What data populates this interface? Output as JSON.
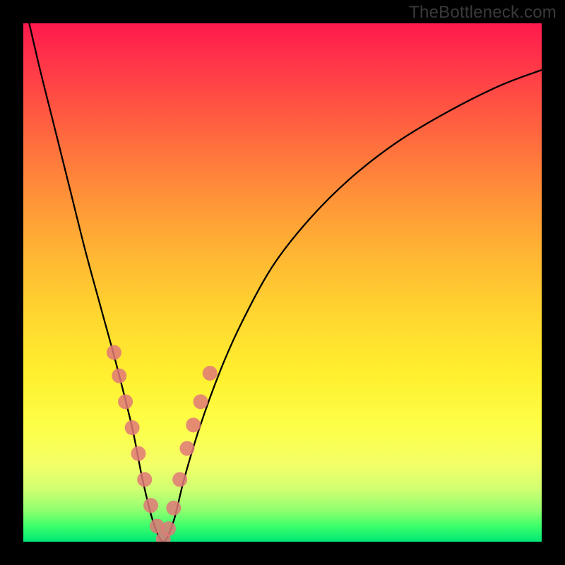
{
  "watermark": "TheBottleneck.com",
  "chart_data": {
    "type": "line",
    "title": "",
    "xlabel": "",
    "ylabel": "",
    "xlim": [
      0,
      100
    ],
    "ylim": [
      0,
      100
    ],
    "series": [
      {
        "name": "bottleneck-curve",
        "x": [
          0,
          3,
          6,
          9,
          12,
          15,
          18,
          21,
          23,
          25,
          27,
          29,
          31,
          34,
          38,
          42,
          48,
          55,
          63,
          72,
          82,
          92,
          100
        ],
        "y": [
          105,
          92,
          80,
          68,
          56,
          45,
          34,
          22,
          12,
          4,
          0,
          4,
          12,
          22,
          33,
          42,
          53,
          62,
          70,
          77,
          83,
          88,
          91
        ]
      }
    ],
    "markers": {
      "name": "highlighted-points",
      "color": "#e07878",
      "x": [
        17.5,
        18.5,
        19.7,
        21.0,
        22.2,
        23.4,
        24.6,
        25.8,
        27.0,
        28.0,
        29.0,
        30.2,
        31.6,
        32.8,
        34.2,
        36.0
      ],
      "y": [
        36.5,
        32.0,
        27.0,
        22.0,
        17.0,
        12.0,
        7.0,
        3.0,
        0.5,
        2.5,
        6.5,
        12.0,
        18.0,
        22.5,
        27.0,
        32.5
      ]
    },
    "background_gradient": {
      "top": "#ff1a4d",
      "mid": "#ffe22f",
      "bottom": "#00e676"
    }
  }
}
